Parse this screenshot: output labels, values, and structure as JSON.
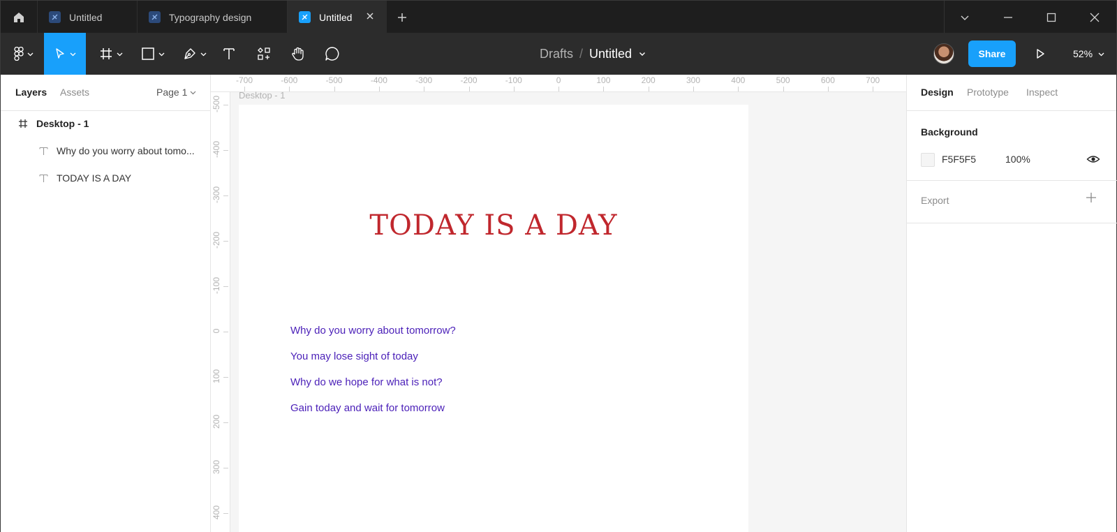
{
  "titlebar": {
    "tabs": [
      {
        "label": "Untitled",
        "active": false
      },
      {
        "label": "Typography design",
        "active": false
      },
      {
        "label": "Untitled",
        "active": true
      }
    ]
  },
  "toolbar": {
    "breadcrumb_root": "Drafts",
    "breadcrumb_separator": "/",
    "file_name": "Untitled",
    "share_label": "Share",
    "zoom": "52%"
  },
  "left_panel": {
    "tabs": {
      "layers": "Layers",
      "assets": "Assets"
    },
    "page_selector": "Page 1",
    "layers": [
      {
        "name": "Desktop - 1",
        "type": "frame"
      },
      {
        "name": "Why do you worry about tomo...",
        "type": "text"
      },
      {
        "name": "TODAY IS A DAY",
        "type": "text"
      }
    ]
  },
  "canvas": {
    "ruler_x": [
      "-700",
      "-600",
      "-500",
      "-400",
      "-300",
      "-200",
      "-100",
      "0",
      "100",
      "200",
      "300",
      "400",
      "500",
      "600",
      "700"
    ],
    "ruler_y": [
      "-500",
      "-400",
      "-300",
      "-200",
      "-100",
      "0",
      "100",
      "200",
      "300",
      "400"
    ],
    "frame_label": "Desktop - 1",
    "headline": "TODAY IS A DAY",
    "headline_color": "#c0272d",
    "body_color": "#4a1fb8",
    "body_lines": [
      "Why do you worry about tomorrow?",
      "You may lose sight of today",
      "Why do we hope for what is not?",
      "Gain today and wait for tomorrow"
    ]
  },
  "right_panel": {
    "tabs": {
      "design": "Design",
      "prototype": "Prototype",
      "inspect": "Inspect"
    },
    "background_title": "Background",
    "background_hex": "F5F5F5",
    "background_opacity": "100%",
    "export_title": "Export"
  },
  "colors": {
    "accent": "#18a0fb",
    "chrome_dark": "#1e1e1e",
    "toolbar": "#2c2c2c"
  }
}
